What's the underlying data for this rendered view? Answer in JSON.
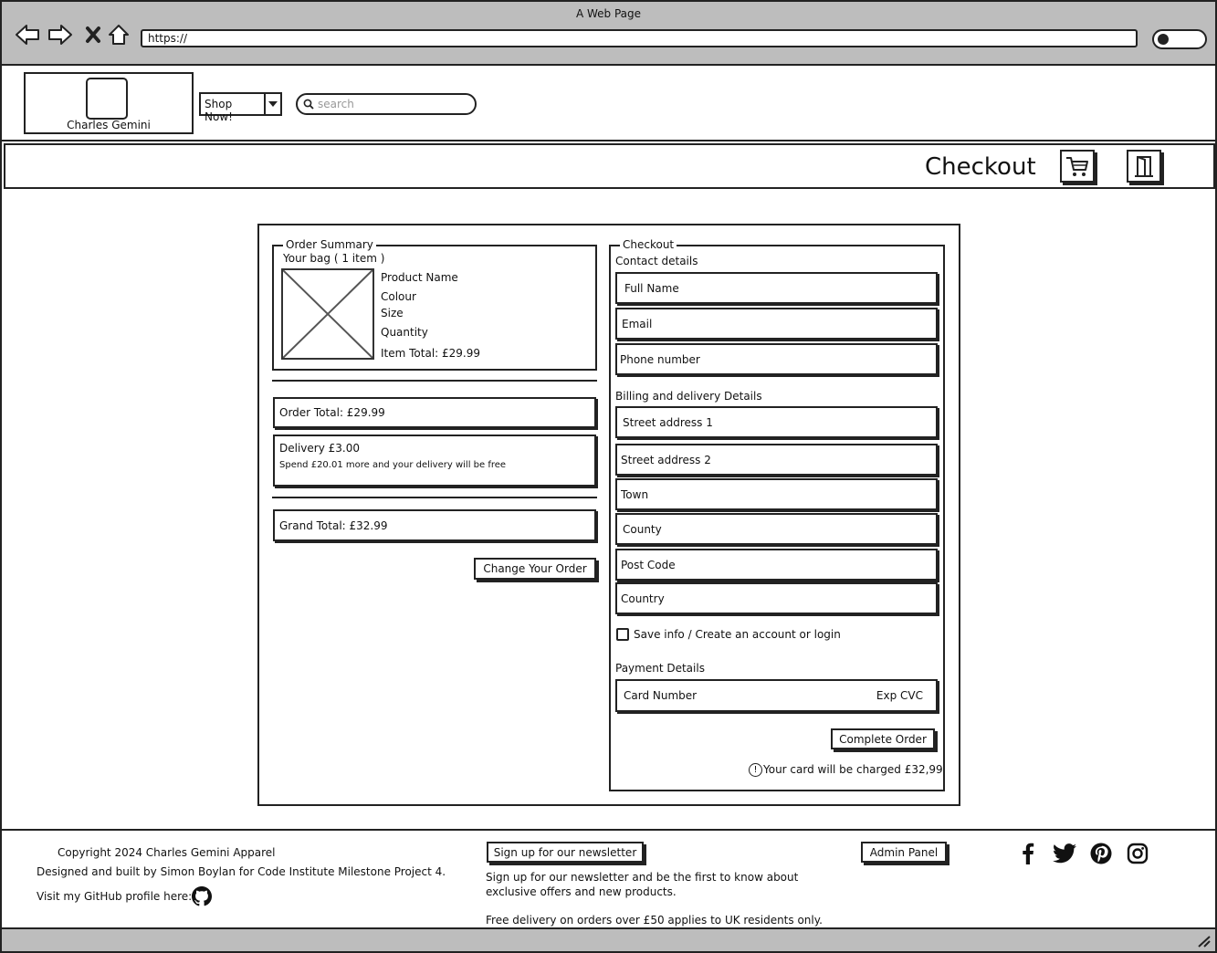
{
  "browser": {
    "window_title": "A Web Page",
    "url": "https://"
  },
  "header": {
    "brand": "Charles Gemini",
    "shop_button": "Shop Now!",
    "search_placeholder": "search"
  },
  "subheader": {
    "title": "Checkout"
  },
  "order_summary": {
    "legend": "Order Summary",
    "bag_label": "Your bag ( 1 item )",
    "product_name": "Product Name",
    "colour": "Colour",
    "size": "Size",
    "quantity": "Quantity",
    "item_total": "Item Total: £29.99",
    "order_total": "Order Total: £29.99",
    "delivery": "Delivery £3.00",
    "delivery_note": "Spend £20.01 more and your delivery will be free",
    "grand_total": "Grand Total: £32.99",
    "change_button": "Change Your Order"
  },
  "checkout": {
    "legend": "Checkout",
    "contact_heading": "Contact details",
    "full_name": "Full Name",
    "email": "Email",
    "phone": "Phone number",
    "billing_heading": "Billing and delivery Details",
    "street1": "Street address 1",
    "street2": "Street address 2",
    "town": "Town",
    "county": "County",
    "postcode": "Post Code",
    "country": "Country",
    "save_info": "Save info / Create an account or login",
    "payment_heading": "Payment Details",
    "card_number": "Card Number",
    "exp_cvc": "Exp CVC",
    "complete_button": "Complete Order",
    "charge_note": "Your card will be charged £32,99"
  },
  "footer": {
    "copyright": "Copyright 2024 Charles Gemini Apparel",
    "designed_by": "Designed and built by Simon Boylan for Code Institute Milestone Project 4.",
    "github": "Visit my GitHub profile here:",
    "newsletter_button": "Sign up for our newsletter",
    "newsletter_text_1": "Sign up for our newsletter and be the first to know about",
    "newsletter_text_2": "exclusive offers and new products.",
    "delivery_note": "Free delivery on orders over £50 applies to UK residents only.",
    "admin_button": "Admin Panel"
  },
  "icons": {
    "back": "back-arrow-icon",
    "forward": "forward-arrow-icon",
    "stop": "close-icon",
    "home": "home-icon",
    "cart": "cart-icon",
    "logout": "door-icon",
    "facebook": "facebook-icon",
    "twitter": "twitter-icon",
    "pinterest": "pinterest-icon",
    "instagram": "instagram-icon",
    "github": "github-icon",
    "info": "info-icon"
  }
}
